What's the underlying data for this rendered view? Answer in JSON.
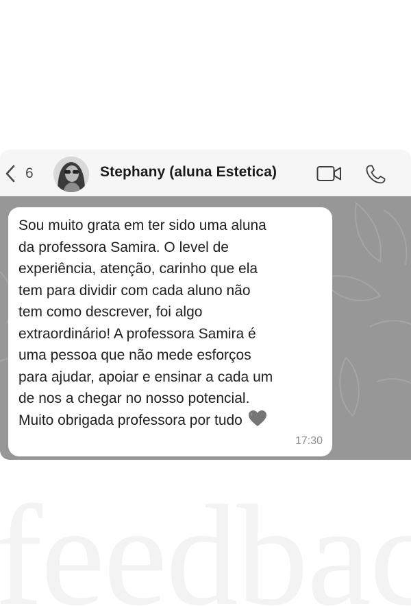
{
  "header": {
    "back_count": "6",
    "contact_name": "Stephany (aluna Estetica)",
    "icons": {
      "back": "chevron-left-icon",
      "avatar": "avatar",
      "video": "video-camera-icon",
      "phone": "phone-icon"
    }
  },
  "message": {
    "text": "Sou muito grata em ter sido uma aluna\nda professora Samira. O level de\nexperiência, atenção, carinho que ela\ntem para dividir com cada aluno não\ntem como descrever, foi algo\nextraordinário! A professora Samira é\numa pessoa que não mede esforços\npara ajudar, apoiar e ensinar a cada um\nde nos a chegar no nosso potencial.\nMuito obrigada professora por tudo",
    "emoji": "grey-heart-icon",
    "time": "17:30"
  },
  "watermark": {
    "text": "feedback"
  },
  "colors": {
    "header_bg": "#f6f6f6",
    "chat_bg": "#979797",
    "bubble_bg": "#ffffff",
    "text": "#1e1e1e",
    "time": "#8e8e8e",
    "watermark": "#f3f3f3"
  }
}
